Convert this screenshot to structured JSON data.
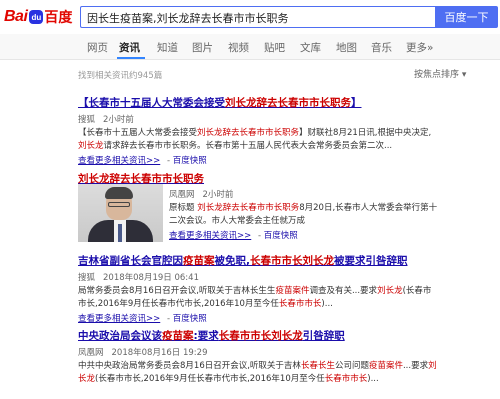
{
  "logo": {
    "bai": "Bai",
    "du": "百度",
    "paw": "du"
  },
  "search": {
    "value": "因长生疫苗案,刘长龙辞去长春市市长职务",
    "button": "百度一下"
  },
  "nav": {
    "tabs": [
      "网页",
      "资讯",
      "知道",
      "图片",
      "视频",
      "贴吧",
      "文库",
      "地图",
      "音乐",
      "更多»"
    ],
    "active_index": 1
  },
  "stats": {
    "text": "找到相关资讯约945篇",
    "sort": "按焦点排序 ▾"
  },
  "results": [
    {
      "title_parts": [
        "【长春市十五届人大常委会接受",
        "刘长龙辞去长春市市长职务",
        "】"
      ],
      "source": "搜狐",
      "time": "2小时前",
      "desc_parts": [
        "【长春市十五届人大常委会接受",
        "刘长龙辞去长春市市长职务",
        "】财联社8月21日讯,根据中央决定,",
        "刘长龙",
        "请求辞去长春市市长职务。长春市第十五届人民代表大会常务委员会第二次..."
      ],
      "more": "查看更多相关资讯>>",
      "cache": "百度快照"
    },
    {
      "title_parts": [
        "",
        "刘长龙辞去长春市市长职务",
        ""
      ],
      "source": "凤凰网",
      "time": "2小时前",
      "desc_parts": [
        "原标题 ",
        "刘长龙辞去长春市市长职务",
        "8月20日,长春市人大常委会举行第十二次会议。市人大常委会主任就万成"
      ],
      "more": "查看更多相关资讯>>",
      "cache": "百度快照"
    },
    {
      "title_parts": [
        "吉林省副省长会官腔因",
        "疫苗案",
        "被免职,",
        "长春市市长刘长龙",
        "被要求引咎辞职"
      ],
      "source": "搜狐",
      "time": "2018年08月19日 06:41",
      "desc_parts": [
        "局常务委员会8月16日召开会议,听取关于吉林长生生",
        "长生生",
        "公司问题",
        "疫苗案件",
        "调查及有关...要求",
        "刘长龙",
        "(长春市市长,2016年9月任长春市代市长,2016年10月至今任",
        "长春市市长",
        ")..."
      ],
      "more": "查看更多相关资讯>>",
      "cache": "百度快照"
    },
    {
      "title_parts": [
        "中央政治局会议该",
        "疫苗案",
        ":要求",
        "长春市市长刘长龙",
        "引咎辞职"
      ],
      "source": "凤凰网",
      "time": "2018年08月16日 19:29",
      "desc_parts": [
        "中共中央政治局常务委员会8月16日召开会议,听取关于吉林",
        "长春长生",
        "公司问题",
        "疫苗案件",
        "...要求",
        "刘长龙",
        "(长春市市长,2016年9月任长春市代市长,2016年10月至今任",
        "长春市市长",
        ")..."
      ],
      "more": "",
      "cache": ""
    }
  ],
  "colors": {
    "link": "#1a0dab",
    "highlight": "#cc0000",
    "accent": "#4e6ef2",
    "tab_underline": "#3385ff"
  }
}
